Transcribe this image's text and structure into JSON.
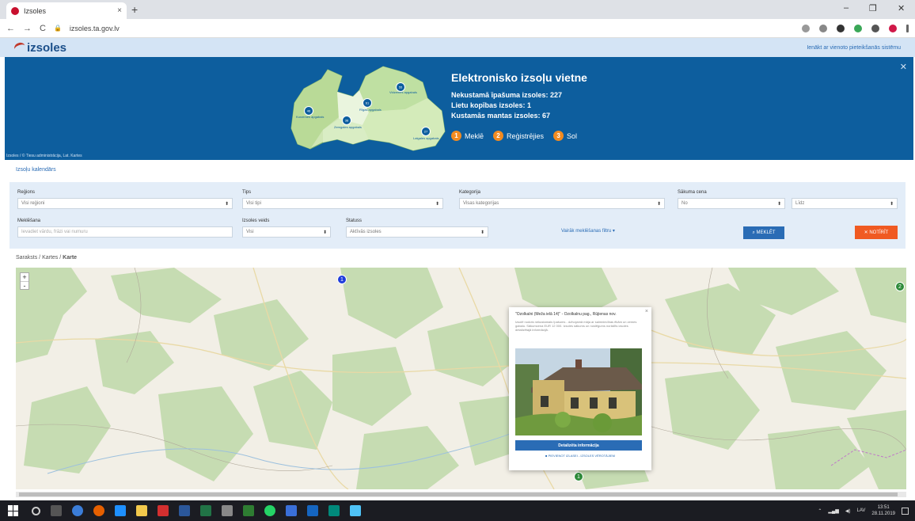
{
  "browser": {
    "tab_title": "Izsoles",
    "tab_close": "×",
    "new_tab": "+",
    "url": "izsoles.ta.gov.lv",
    "window_controls": [
      "–",
      "❐",
      "✕"
    ],
    "nav": [
      "←",
      "→",
      "C"
    ]
  },
  "site": {
    "logo_text": "izsoles",
    "login_text": "Ienākt ar vienoto pieteikšanās sistēmu",
    "banner": {
      "title": "Elektronisko izsoļu vietne",
      "stats": [
        "Nekustamā īpašuma izsoles: 227",
        "Lietu kopības izsoles: 1",
        "Kustamās mantas izsoles: 67"
      ],
      "steps": [
        {
          "num": "1",
          "label": "Meklē"
        },
        {
          "num": "2",
          "label": "Reģistrējies"
        },
        {
          "num": "3",
          "label": "Sol"
        }
      ],
      "map_regions": [
        {
          "label": "Kurzemes apgabals",
          "count": "46"
        },
        {
          "label": "Zemgales apgabals",
          "count": "38"
        },
        {
          "label": "Rīgas apgabals",
          "count": "61"
        },
        {
          "label": "Vidzemes apgabals",
          "count": "55"
        },
        {
          "label": "Latgales apgabals",
          "count": "27"
        }
      ],
      "credit": "Izsoles / © Tiesu administrācija, Lat. Kartes",
      "close": "✕"
    },
    "subnav": "Izsoļu kalendārs"
  },
  "filters": {
    "region": {
      "label": "Reģions",
      "value": "Visi reģioni"
    },
    "type": {
      "label": "Tips",
      "value": "Visi tipi"
    },
    "category": {
      "label": "Kategorija",
      "value": "Visas kategorijas"
    },
    "start_price": {
      "label": "Sākuma cena",
      "from": "No",
      "to": "Līdz"
    },
    "keyword": {
      "label": "Meklēšana",
      "placeholder": "Ievadiet vārdu, frāzi vai numuru"
    },
    "auction_type": {
      "label": "Izsoles veids",
      "value": "Visi"
    },
    "status": {
      "label": "Statuss",
      "value": "Aktīvās izsoles"
    },
    "more_link": "Vairāk meklēšanas filtru ▾",
    "search_button": "MEKLĒT",
    "clear_button": "NOTĪRĪT"
  },
  "view_switch": {
    "prefix": "Saraksts / Kartes / ",
    "active": "Karte"
  },
  "map": {
    "zoom_in": "+",
    "zoom_out": "-",
    "markers": [
      {
        "id": "m1",
        "count": "1",
        "color": "#1f3cdb"
      },
      {
        "id": "m2",
        "count": "2",
        "color": "#2e8b3a"
      },
      {
        "id": "m3",
        "count": "1",
        "color": "#2e8b3a"
      }
    ]
  },
  "popup": {
    "close": "×",
    "title": "\"Ozolkalni (Meža ielā 14)\" - Ozolkalnu pag., Rūjienas nov.",
    "description": "Izsolē nodots nekustamais īpašums - dzīvojamā māja ar saimniecības ēkām un zemes gabalu. Sākumcena EUR 12 000. Izsoles sākums un noslēgums norādīts izsoles detalizētajā informācijā.",
    "details_button": "Detalizēta informācija",
    "favorite_link": "PIEVIENOT IZLASEI - IZSOLES VĒROTĀJIEM"
  },
  "taskbar": {
    "tray_lang": "LAV",
    "time": "13:51",
    "date": "28.11.2019"
  },
  "colors": {
    "banner": "#0d5e9e",
    "accent_orange": "#f28b20",
    "button_blue": "#2a6cb5",
    "button_orange": "#f05a22"
  }
}
